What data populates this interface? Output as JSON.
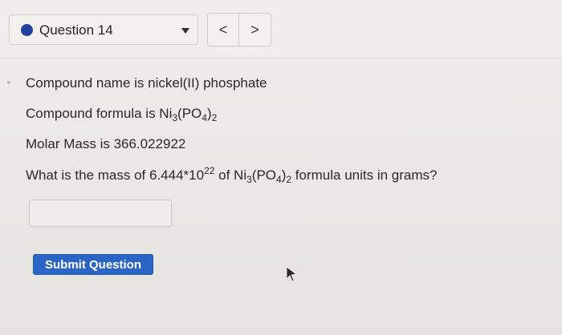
{
  "header": {
    "question_label": "Question 14",
    "status_dot_color": "#2140a0",
    "dropdown_icon": "triangle-down-icon",
    "prev_label": "<",
    "next_label": ">"
  },
  "question": {
    "name_prefix": "Compound name is nickel(II) phosphate",
    "formula_prefix": "Compound formula is Ni",
    "formula_sub1": "3",
    "formula_mid": "(PO",
    "formula_sub2": "4",
    "formula_close": ")",
    "formula_sub3": "2",
    "molar_mass": "Molar Mass is 366.022922",
    "prompt_prefix": "What is the mass of 6.444*10",
    "prompt_exp": "22",
    "prompt_mid": " of Ni",
    "prompt_sub1": "3",
    "prompt_mid2": "(PO",
    "prompt_sub2": "4",
    "prompt_mid3": ")",
    "prompt_sub3": "2",
    "prompt_suffix": " formula units in grams?"
  },
  "answer": {
    "value": "",
    "placeholder": ""
  },
  "submit": {
    "label": "Submit Question",
    "color": "#2a64c4"
  },
  "cursor_icon": "mouse-pointer-icon"
}
